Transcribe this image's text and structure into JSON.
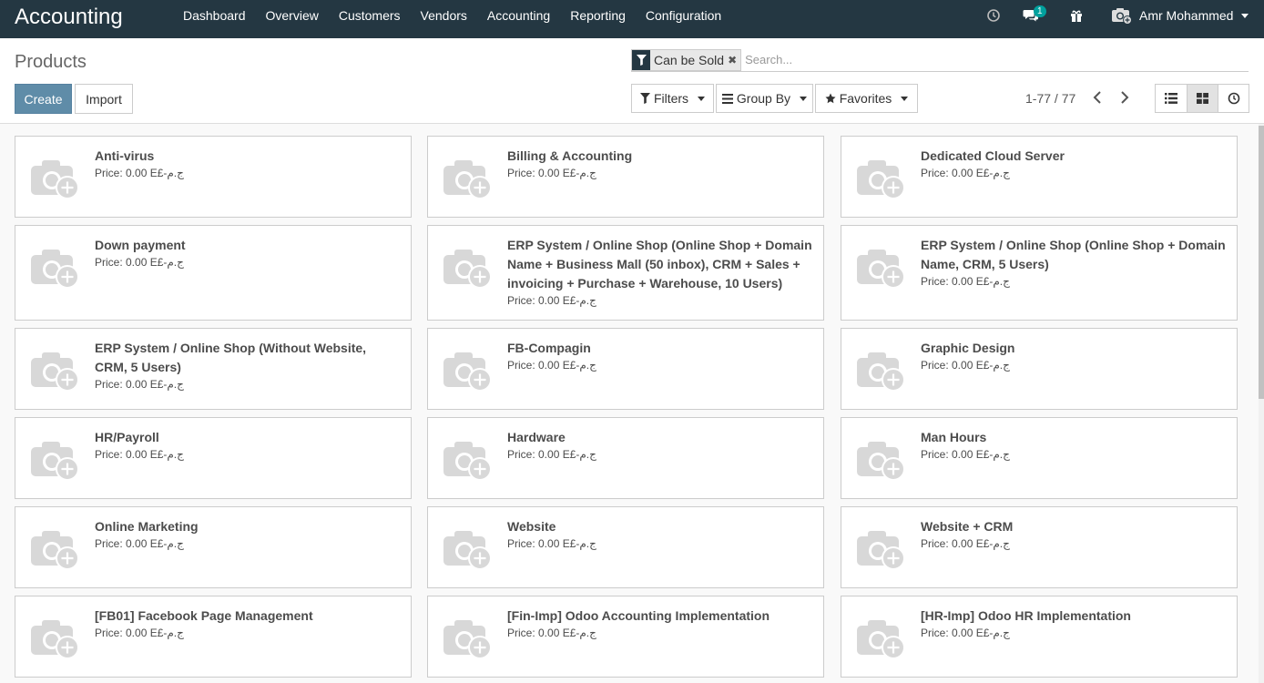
{
  "navbar": {
    "app_title": "Accounting",
    "menu": [
      "Dashboard",
      "Overview",
      "Customers",
      "Vendors",
      "Accounting",
      "Reporting",
      "Configuration"
    ],
    "chat_badge": "1",
    "user_name": "Amr Mohammed"
  },
  "control_panel": {
    "breadcrumb": "Products",
    "create_label": "Create",
    "import_label": "Import",
    "facet_value": "Can be Sold",
    "search_placeholder": "Search...",
    "filters_label": "Filters",
    "groupby_label": "Group By",
    "favorites_label": "Favorites",
    "pager_value": "1-77 / 77"
  },
  "products": [
    {
      "name": "Anti-virus",
      "price": "Price: 0.00 E£-ج.م"
    },
    {
      "name": "Billing & Accounting",
      "price": "Price: 0.00 E£-ج.م"
    },
    {
      "name": "Dedicated Cloud Server",
      "price": "Price: 0.00 E£-ج.م"
    },
    {
      "name": "Down payment",
      "price": "Price: 0.00 E£-ج.م"
    },
    {
      "name": "ERP System / Online Shop (Online Shop + Domain Name + Business Mall (50 inbox), CRM + Sales + invoicing + Purchase + Warehouse, 10 Users)",
      "price": "Price: 0.00 E£-ج.م"
    },
    {
      "name": "ERP System / Online Shop (Online Shop + Domain Name, CRM, 5 Users)",
      "price": "Price: 0.00 E£-ج.م"
    },
    {
      "name": "ERP System / Online Shop (Without Website, CRM, 5 Users)",
      "price": "Price: 0.00 E£-ج.م"
    },
    {
      "name": "FB-Compagin",
      "price": "Price: 0.00 E£-ج.م"
    },
    {
      "name": "Graphic Design",
      "price": "Price: 0.00 E£-ج.م"
    },
    {
      "name": "HR/Payroll",
      "price": "Price: 0.00 E£-ج.م"
    },
    {
      "name": "Hardware",
      "price": "Price: 0.00 E£-ج.م"
    },
    {
      "name": "Man Hours",
      "price": "Price: 0.00 E£-ج.م"
    },
    {
      "name": "Online Marketing",
      "price": "Price: 0.00 E£-ج.م"
    },
    {
      "name": "Website",
      "price": "Price: 0.00 E£-ج.م"
    },
    {
      "name": "Website + CRM",
      "price": "Price: 0.00 E£-ج.م"
    },
    {
      "name": "[FB01] Facebook Page Management",
      "price": "Price: 0.00 E£-ج.م"
    },
    {
      "name": "[Fin-Imp] Odoo Accounting Implementation",
      "price": "Price: 0.00 E£-ج.م"
    },
    {
      "name": "[HR-Imp] Odoo HR Implementation",
      "price": "Price: 0.00 E£-ج.م"
    }
  ]
}
